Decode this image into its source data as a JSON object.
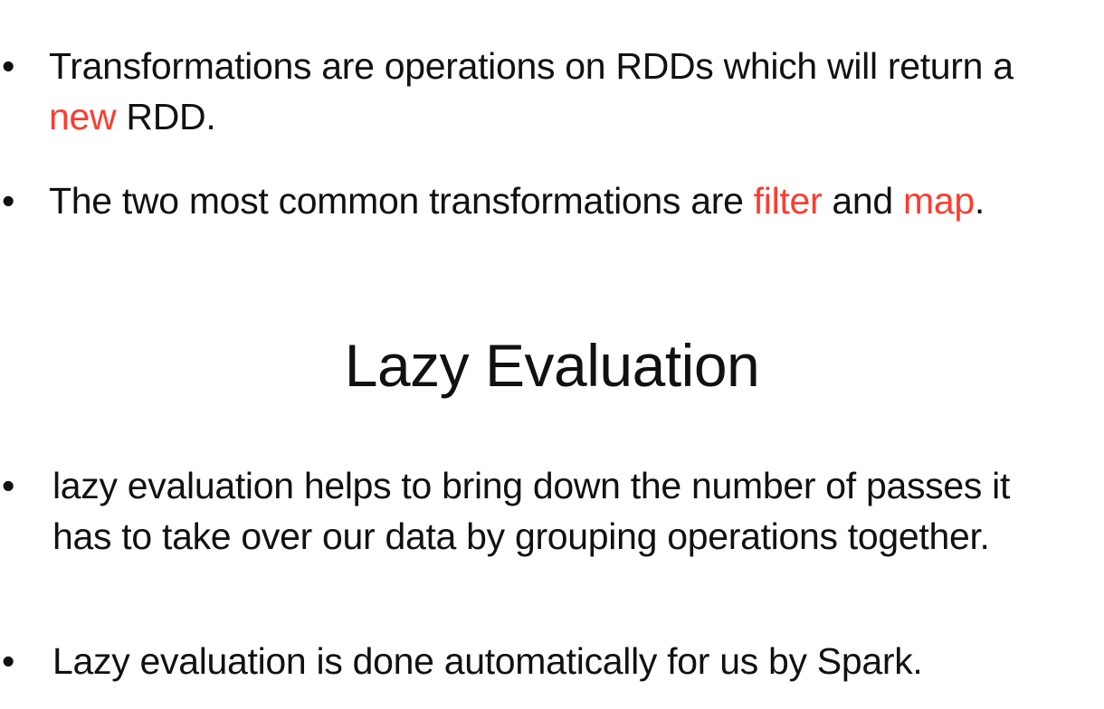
{
  "bullet_glyph": "•",
  "top_bullets": [
    {
      "line1": "Transformations are operations on RDDs which will return a",
      "line2_highlight": "new",
      "line2_rest": " RDD."
    },
    {
      "prefix": "The two most common transformations are ",
      "highlight1": "filter",
      "middle": " and ",
      "highlight2": "map",
      "suffix": "."
    }
  ],
  "heading": "Lazy Evaluation",
  "bottom_bullets": [
    {
      "line1": "lazy evaluation helps to bring down the number of passes it",
      "line2": "has to take over our data by grouping operations together."
    },
    {
      "line1": "Lazy evaluation is done automatically for us by Spark."
    }
  ],
  "colors": {
    "highlight": "#ff3b2f",
    "text": "#111111",
    "background": "#ffffff"
  }
}
